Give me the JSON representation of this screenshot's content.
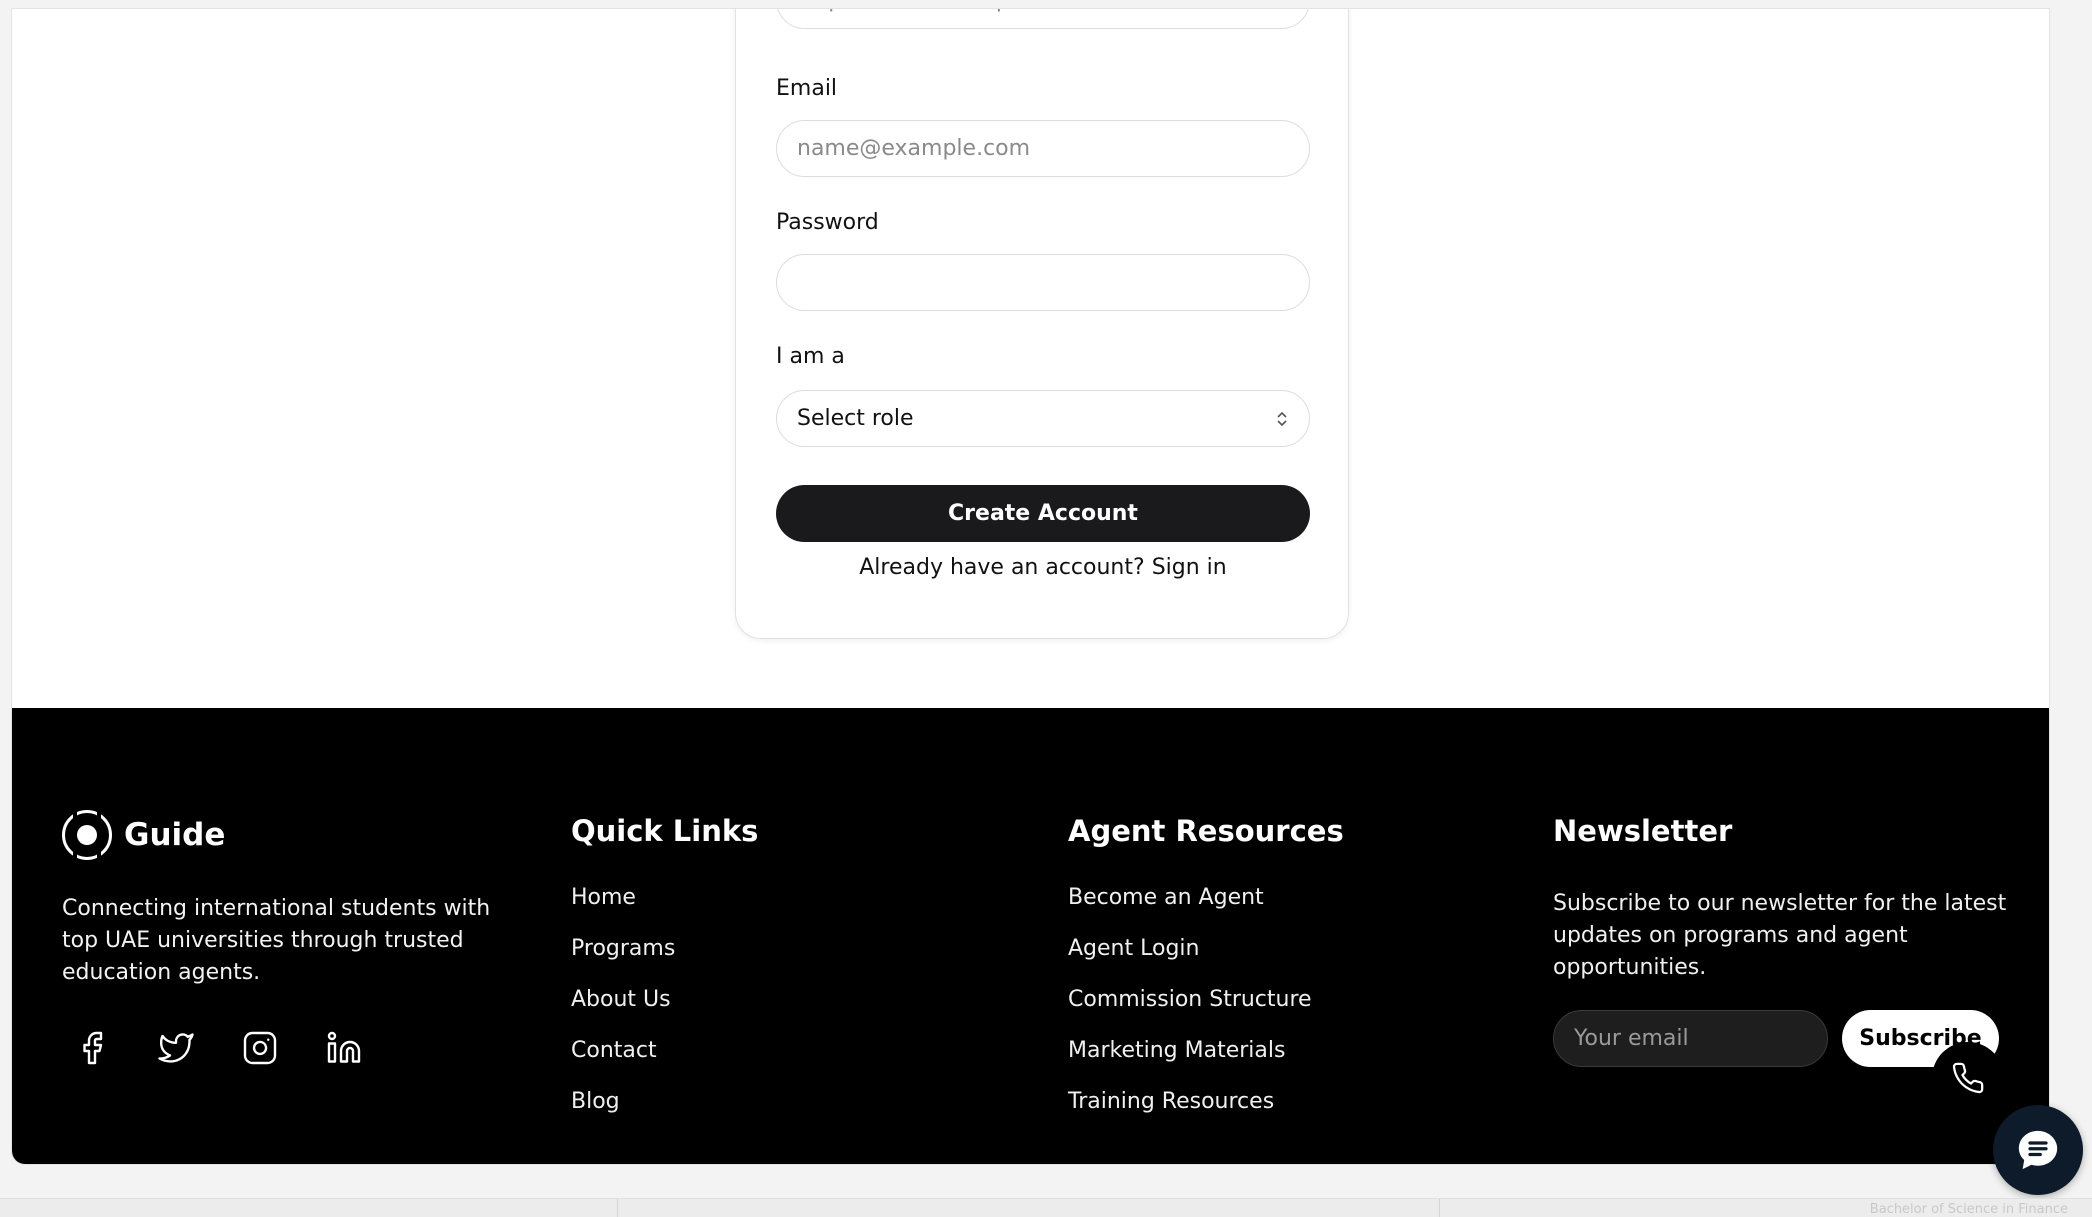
{
  "form": {
    "website_placeholder": "https://www.example.com",
    "email_label": "Email",
    "email_placeholder": "name@example.com",
    "password_label": "Password",
    "password_value": "",
    "role_label": "I am a",
    "role_selected": "Select role",
    "create_button": "Create Account",
    "signin_prompt": "Already have an account?",
    "signin_link": "Sign in"
  },
  "footer": {
    "brand_name": "Guide",
    "tagline": "Connecting international students with top UAE universities through trusted education agents.",
    "social_icons": [
      "facebook-icon",
      "twitter-icon",
      "instagram-icon",
      "linkedin-icon"
    ],
    "quick_links": {
      "title": "Quick Links",
      "items": [
        "Home",
        "Programs",
        "About Us",
        "Contact",
        "Blog"
      ]
    },
    "agent_resources": {
      "title": "Agent Resources",
      "items": [
        "Become an Agent",
        "Agent Login",
        "Commission Structure",
        "Marketing Materials",
        "Training Resources"
      ]
    },
    "newsletter": {
      "title": "Newsletter",
      "text": "Subscribe to our newsletter for the latest updates on programs and agent opportunities.",
      "email_placeholder": "Your email",
      "subscribe_button": "Subscribe"
    }
  },
  "bottom_strip": {
    "ghost_text": "Bachelor of Science in Finance"
  },
  "colors": {
    "footer_bg": "#000000",
    "primary_button": "#1a1a1c",
    "chat_fab": "#0d1b2a"
  }
}
